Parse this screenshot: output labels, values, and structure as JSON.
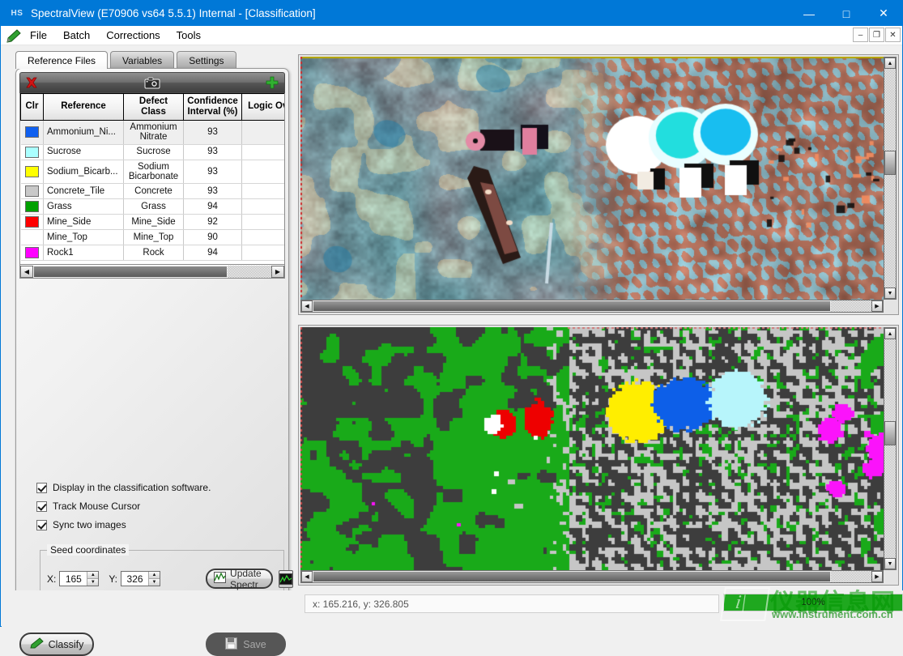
{
  "window": {
    "logo_text": "HS",
    "title": "SpectralView (E70906 vs64 5.5.1) Internal - [Classification]",
    "minimize": "—",
    "maximize": "□",
    "close": "✕"
  },
  "mdi": {
    "minimize": "–",
    "restore": "❐",
    "close": "✕"
  },
  "menu": {
    "items": [
      "File",
      "Batch",
      "Corrections",
      "Tools"
    ]
  },
  "tabs": [
    {
      "label": "Reference Files",
      "active": true
    },
    {
      "label": "Variables",
      "active": false
    },
    {
      "label": "Settings",
      "active": false
    }
  ],
  "grid_toolbar": {
    "delete_title": "Delete",
    "camera_title": "Capture",
    "add_title": "Add"
  },
  "grid": {
    "columns": [
      "Clr",
      "Reference",
      "Defect Class",
      "Confidence Interval (%)",
      "Logic Overri"
    ],
    "rows": [
      {
        "color": "#1060f0",
        "reference": "Ammonium_Ni...",
        "defect_class": "Ammonium Nitrate",
        "confidence": "93",
        "logic_override": "true",
        "selected": true
      },
      {
        "color": "#aaffff",
        "reference": "Sucrose",
        "defect_class": "Sucrose",
        "confidence": "93",
        "logic_override": "true",
        "selected": false
      },
      {
        "color": "#ffff00",
        "reference": "Sodium_Bicarb...",
        "defect_class": "Sodium Bicarbonate",
        "confidence": "93",
        "logic_override": "true",
        "selected": false
      },
      {
        "color": "#c8c8c8",
        "reference": "Concrete_Tile",
        "defect_class": "Concrete",
        "confidence": "93",
        "logic_override": "true",
        "selected": false
      },
      {
        "color": "#00a000",
        "reference": "Grass",
        "defect_class": "Grass",
        "confidence": "94",
        "logic_override": "true",
        "selected": false
      },
      {
        "color": "#ff0000",
        "reference": "Mine_Side",
        "defect_class": "Mine_Side",
        "confidence": "92",
        "logic_override": "true",
        "selected": false
      },
      {
        "color": "#ffffff",
        "reference": "Mine_Top",
        "defect_class": "Mine_Top",
        "confidence": "90",
        "logic_override": "true",
        "selected": false
      },
      {
        "color": "#ff00ff",
        "reference": "Rock1",
        "defect_class": "Rock",
        "confidence": "94",
        "logic_override": "true",
        "selected": false
      }
    ]
  },
  "options": {
    "display_in_classification": {
      "label": "Display in the classification software.",
      "checked": true
    },
    "track_mouse_cursor": {
      "label": "Track Mouse Cursor",
      "checked": true
    },
    "sync_two_images": {
      "label": "Sync two images",
      "checked": true
    }
  },
  "seed_coordinates": {
    "group_title": "Seed coordinates",
    "x_label": "X:",
    "x_value": "165",
    "y_label": "Y:",
    "y_value": "326",
    "update_button": "Update Spectr",
    "spin_up": "▲",
    "spin_down": "▼"
  },
  "buttons": {
    "classify": "Classify",
    "save": "Save"
  },
  "status": {
    "coordinates": "x: 165.216, y: 326.805",
    "progress_text": "100%",
    "progress_percent": 100,
    "progress_color": "#1fa81f"
  },
  "watermark": {
    "chinese": "仪器信息网",
    "url": "www.instrument.com.cn"
  },
  "scrollbars": {
    "up": "▲",
    "down": "▼",
    "left": "◀",
    "right": "▶"
  },
  "image_panels": [
    {
      "name": "hyperspectral-rgb-preview"
    },
    {
      "name": "classification-result-map"
    }
  ]
}
